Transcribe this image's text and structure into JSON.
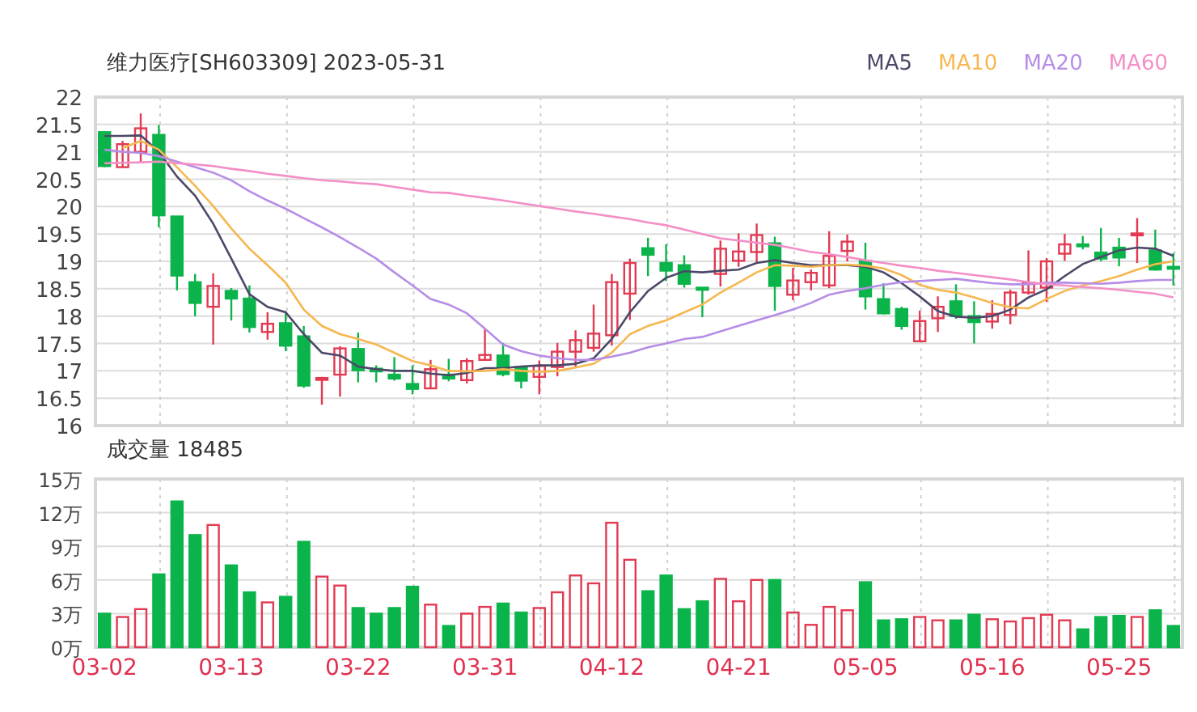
{
  "header": {
    "title": "维力医疗[SH603309] 2023-05-31"
  },
  "price_chart": {
    "chart_data": {
      "type": "candlestick",
      "grid": true,
      "categories": [
        null,
        null,
        null,
        null,
        null,
        null,
        null,
        null,
        null,
        null,
        null,
        null,
        null,
        null,
        null,
        null,
        null,
        null,
        null,
        null,
        null,
        null,
        null,
        null,
        null,
        null,
        null,
        null,
        null,
        null,
        null,
        null,
        null,
        null,
        null,
        null,
        null,
        null,
        null,
        null,
        null,
        null,
        null,
        null,
        null,
        null,
        null,
        null,
        null,
        null,
        null,
        null,
        null,
        null,
        null,
        null,
        null,
        null,
        null,
        null
      ],
      "ylim": [
        16,
        22
      ],
      "ohlc": [
        [
          21.36,
          21.38,
          20.72,
          20.74
        ],
        [
          20.72,
          21.2,
          20.72,
          21.14
        ],
        [
          21.0,
          21.7,
          20.8,
          21.43
        ],
        [
          21.31,
          21.49,
          19.62,
          19.84
        ],
        [
          19.82,
          19.82,
          18.47,
          18.74
        ],
        [
          18.62,
          18.77,
          18.0,
          18.24
        ],
        [
          18.17,
          18.78,
          17.48,
          18.55
        ],
        [
          18.46,
          18.51,
          17.92,
          18.32
        ],
        [
          18.32,
          18.56,
          17.7,
          17.8
        ],
        [
          17.71,
          18.07,
          17.57,
          17.86
        ],
        [
          17.87,
          18.09,
          17.36,
          17.46
        ],
        [
          17.63,
          17.82,
          16.69,
          16.73
        ],
        [
          16.86,
          16.89,
          16.38,
          16.87
        ],
        [
          16.93,
          17.45,
          16.53,
          17.41
        ],
        [
          17.4,
          17.7,
          16.79,
          17.01
        ],
        [
          17.04,
          17.1,
          16.79,
          16.99
        ],
        [
          16.93,
          17.25,
          16.82,
          16.86
        ],
        [
          16.76,
          17.1,
          16.57,
          16.67
        ],
        [
          16.68,
          17.2,
          16.68,
          17.03
        ],
        [
          16.93,
          17.22,
          16.81,
          16.86
        ],
        [
          16.83,
          17.23,
          16.77,
          17.18
        ],
        [
          17.2,
          17.76,
          17.2,
          17.29
        ],
        [
          17.28,
          17.51,
          16.9,
          16.94
        ],
        [
          17.07,
          17.09,
          16.68,
          16.82
        ],
        [
          16.89,
          17.19,
          16.57,
          17.09
        ],
        [
          17.07,
          17.51,
          16.9,
          17.35
        ],
        [
          17.35,
          17.74,
          17.08,
          17.56
        ],
        [
          17.42,
          18.21,
          17.35,
          17.68
        ],
        [
          17.65,
          18.77,
          17.46,
          18.62
        ],
        [
          18.41,
          19.05,
          17.93,
          18.97
        ],
        [
          19.24,
          19.43,
          18.73,
          19.12
        ],
        [
          18.97,
          19.31,
          18.64,
          18.83
        ],
        [
          18.93,
          19.11,
          18.52,
          18.59
        ],
        [
          18.52,
          18.52,
          17.98,
          18.48
        ],
        [
          18.77,
          19.38,
          18.54,
          19.23
        ],
        [
          19.01,
          19.51,
          18.9,
          19.18
        ],
        [
          19.17,
          19.69,
          18.98,
          19.48
        ],
        [
          19.33,
          19.45,
          18.1,
          18.55
        ],
        [
          18.39,
          18.88,
          18.29,
          18.65
        ],
        [
          18.62,
          18.85,
          18.47,
          18.79
        ],
        [
          18.56,
          19.55,
          18.51,
          19.1
        ],
        [
          19.19,
          19.49,
          19.0,
          19.36
        ],
        [
          19.01,
          19.34,
          18.12,
          18.36
        ],
        [
          18.31,
          18.6,
          18.03,
          18.05
        ],
        [
          18.13,
          18.17,
          17.75,
          17.82
        ],
        [
          17.54,
          18.1,
          17.54,
          17.91
        ],
        [
          17.96,
          18.36,
          17.71,
          18.17
        ],
        [
          18.27,
          18.58,
          17.95,
          18.0
        ],
        [
          18.0,
          18.27,
          17.5,
          17.89
        ],
        [
          17.9,
          18.29,
          17.77,
          18.04
        ],
        [
          18.02,
          18.48,
          17.85,
          18.43
        ],
        [
          18.43,
          19.2,
          18.39,
          18.61
        ],
        [
          18.52,
          19.06,
          18.26,
          19.0
        ],
        [
          19.14,
          19.5,
          19.01,
          19.31
        ],
        [
          19.31,
          19.46,
          19.22,
          19.29
        ],
        [
          19.16,
          19.61,
          19.0,
          19.05
        ],
        [
          19.25,
          19.43,
          18.91,
          19.07
        ],
        [
          19.5,
          19.79,
          18.97,
          19.51
        ],
        [
          19.2,
          19.58,
          18.83,
          18.85
        ],
        [
          18.9,
          19.15,
          18.56,
          18.87
        ]
      ]
    }
  },
  "moving_averages": {
    "chart_data": {
      "type": "line",
      "categories": [
        null,
        null,
        null,
        null,
        null,
        null,
        null,
        null,
        null,
        null,
        null,
        null,
        null,
        null,
        null,
        null,
        null,
        null,
        null,
        null,
        null,
        null,
        null,
        null,
        null,
        null,
        null,
        null,
        null,
        null,
        null,
        null,
        null,
        null,
        null,
        null,
        null,
        null,
        null,
        null,
        null,
        null,
        null,
        null,
        null,
        null,
        null,
        null,
        null,
        null,
        null,
        null,
        null,
        null,
        null,
        null,
        null,
        null,
        null,
        null
      ],
      "yticks": [
        16,
        16.5,
        17,
        17.5,
        18,
        18.5,
        19,
        19.5,
        20,
        20.5,
        21,
        21.5,
        22
      ],
      "ylim": [
        16,
        22
      ],
      "series": [
        {
          "name": "MA5",
          "color": "#4b4868",
          "values": [
            21.29,
            21.29,
            21.3,
            21.0,
            20.55,
            20.2,
            19.69,
            19.05,
            18.4,
            18.17,
            18.07,
            17.67,
            17.33,
            17.28,
            17.08,
            17.03,
            17.0,
            17.0,
            16.95,
            16.92,
            16.96,
            17.05,
            17.05,
            17.08,
            17.1,
            17.1,
            17.13,
            17.23,
            17.58,
            18.07,
            18.46,
            18.7,
            18.82,
            18.8,
            18.83,
            18.85,
            18.97,
            19.02,
            18.97,
            18.93,
            18.93,
            18.93,
            18.9,
            18.8,
            18.6,
            18.36,
            18.09,
            17.99,
            17.97,
            18.0,
            18.12,
            18.34,
            18.49,
            18.73,
            18.95,
            19.08,
            19.2,
            19.25,
            19.23,
            19.1
          ]
        },
        {
          "name": "MA10",
          "color": "#f6b74f",
          "values": [
            null,
            21.07,
            21.2,
            21.04,
            20.72,
            20.38,
            20.01,
            19.6,
            19.23,
            18.93,
            18.61,
            18.12,
            17.82,
            17.67,
            17.58,
            17.48,
            17.33,
            17.18,
            17.1,
            17.0,
            16.99,
            17.0,
            17.03,
            17.0,
            16.98,
            17.0,
            17.06,
            17.13,
            17.33,
            17.67,
            17.82,
            17.92,
            18.07,
            18.21,
            18.43,
            18.61,
            18.8,
            18.93,
            18.92,
            18.9,
            18.93,
            18.94,
            18.92,
            18.87,
            18.75,
            18.57,
            18.48,
            18.43,
            18.34,
            18.24,
            18.16,
            18.14,
            18.31,
            18.46,
            18.56,
            18.64,
            18.73,
            18.85,
            18.95,
            19.0
          ]
        },
        {
          "name": "MA20",
          "color": "#b68de6",
          "values": [
            21.04,
            21.0,
            20.98,
            20.92,
            20.82,
            20.72,
            20.62,
            20.48,
            20.28,
            20.11,
            19.96,
            19.79,
            19.62,
            19.44,
            19.25,
            19.05,
            18.8,
            18.56,
            18.31,
            18.21,
            18.05,
            17.77,
            17.48,
            17.36,
            17.28,
            17.23,
            17.2,
            17.2,
            17.26,
            17.33,
            17.43,
            17.5,
            17.58,
            17.62,
            17.72,
            17.82,
            17.92,
            18.02,
            18.12,
            18.24,
            18.39,
            18.46,
            18.51,
            18.57,
            18.62,
            18.64,
            18.66,
            18.68,
            18.64,
            18.6,
            18.58,
            18.58,
            18.61,
            18.61,
            18.6,
            18.59,
            18.61,
            18.64,
            18.66,
            18.66
          ]
        },
        {
          "name": "MA60",
          "color": "#f38fc6",
          "values": [
            20.79,
            20.8,
            20.81,
            20.82,
            20.79,
            20.77,
            20.74,
            20.69,
            20.65,
            20.6,
            20.56,
            20.52,
            20.48,
            20.46,
            20.43,
            20.41,
            20.36,
            20.31,
            20.26,
            20.25,
            20.2,
            20.16,
            20.11,
            20.06,
            20.01,
            19.96,
            19.91,
            19.87,
            19.82,
            19.77,
            19.71,
            19.66,
            19.58,
            19.5,
            19.42,
            19.38,
            19.34,
            19.3,
            19.24,
            19.17,
            19.13,
            19.08,
            19.02,
            18.97,
            18.92,
            18.88,
            18.83,
            18.79,
            18.75,
            18.71,
            18.67,
            18.62,
            18.58,
            18.56,
            18.53,
            18.51,
            18.48,
            18.44,
            18.41,
            18.34
          ]
        }
      ]
    }
  },
  "volume_chart": {
    "title": "成交量 18485",
    "chart_data": {
      "type": "bar",
      "grid": true,
      "ylim": [
        0,
        15
      ],
      "categories": [
        "03-02",
        null,
        null,
        null,
        null,
        null,
        null,
        "03-13",
        null,
        null,
        null,
        null,
        null,
        null,
        "03-22",
        null,
        null,
        null,
        null,
        null,
        null,
        "03-31",
        null,
        null,
        null,
        null,
        null,
        null,
        "04-12",
        null,
        null,
        null,
        null,
        null,
        null,
        "04-21",
        null,
        null,
        null,
        null,
        null,
        null,
        "05-05",
        null,
        null,
        null,
        null,
        null,
        null,
        "05-16",
        null,
        null,
        null,
        null,
        null,
        null,
        "05-25",
        null,
        null,
        null
      ],
      "yticks": [
        {
          "value": 0,
          "label": "0万"
        },
        {
          "value": 3,
          "label": "3万"
        },
        {
          "value": 6,
          "label": "6万"
        },
        {
          "value": 9,
          "label": "9万"
        },
        {
          "value": 12,
          "label": "12万"
        },
        {
          "value": 15,
          "label": "15万"
        }
      ],
      "values": [
        3.0,
        2.7,
        3.4,
        6.5,
        13.0,
        10.0,
        10.9,
        7.3,
        4.9,
        4.0,
        4.5,
        9.4,
        6.3,
        5.5,
        3.5,
        3.0,
        3.5,
        5.4,
        3.8,
        1.9,
        3.0,
        3.6,
        3.9,
        3.1,
        3.5,
        4.9,
        6.4,
        5.7,
        11.1,
        7.8,
        5.0,
        6.4,
        3.4,
        4.1,
        6.1,
        4.1,
        6.0,
        6.0,
        3.1,
        2.0,
        3.6,
        3.3,
        5.8,
        2.4,
        2.5,
        2.7,
        2.4,
        2.4,
        2.9,
        2.5,
        2.3,
        2.6,
        2.9,
        2.4,
        1.6,
        2.7,
        2.8,
        2.7,
        3.3,
        1.9
      ]
    }
  }
}
